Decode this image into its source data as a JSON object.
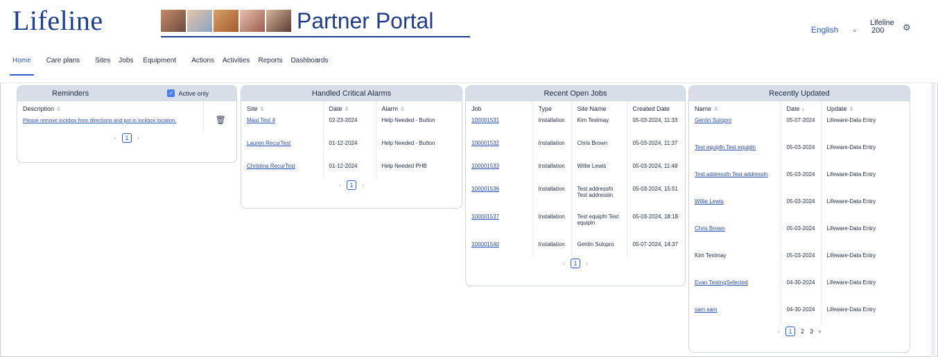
{
  "header": {
    "brand": "Lifeline",
    "portal_title": "Partner Portal",
    "language": "English",
    "user_line1": "Lifeline",
    "user_line2": "200"
  },
  "nav": [
    "Home",
    "Care plans",
    "Sites",
    "Jobs",
    "Equipment",
    "Actions",
    "Activities",
    "Reports",
    "Dashboards"
  ],
  "colors": {
    "accent": "#2a5bd7",
    "brand": "#1c3f8f",
    "panel_header": "#d7dee7"
  },
  "reminders": {
    "title": "Reminders",
    "active_only": "Active only",
    "col_description": "Description",
    "rows": [
      {
        "description": "Please remove lockbox from directions and put in lockbox location."
      }
    ],
    "page": "1"
  },
  "alarms": {
    "title": "Handled Critical Alarms",
    "cols": [
      "Site",
      "Date",
      "Alarm"
    ],
    "rows": [
      {
        "site": "Maui Test 4",
        "date": "02-23-2024",
        "alarm": "Help Needed - Button"
      },
      {
        "site": "Lauren RecurTest",
        "date": "01-12-2024",
        "alarm": "Help Needed - Button"
      },
      {
        "site": "Christina RecurTest",
        "date": "01-12-2024",
        "alarm": "Help Needed PHB"
      }
    ],
    "page": "1"
  },
  "jobs": {
    "title": "Recent Open Jobs",
    "cols": [
      "Job",
      "Type",
      "Site Name",
      "Created Date"
    ],
    "rows": [
      {
        "job": "100001531",
        "type": "Installation",
        "site": "Kim Testmay",
        "date": "05-03-2024, 11:33"
      },
      {
        "job": "100001532",
        "type": "Installation",
        "site": "Chris Brown",
        "date": "05-03-2024, 11:37"
      },
      {
        "job": "100001533",
        "type": "Installation",
        "site": "Willie Lewis",
        "date": "05-03-2024, 11:48"
      },
      {
        "job": "100001536",
        "type": "Installation",
        "site": "Test addressfn Test addressln",
        "date": "05-03-2024, 15:51"
      },
      {
        "job": "100001537",
        "type": "Installation",
        "site": "Test equipfn Test equipln",
        "date": "05-03-2024, 18:18"
      },
      {
        "job": "100001540",
        "type": "Installation",
        "site": "Gentin Sulopro",
        "date": "05-07-2024, 14:37"
      }
    ],
    "page": "1"
  },
  "updated": {
    "title": "Recently Updated",
    "cols": [
      "Name",
      "Date",
      "Update"
    ],
    "rows": [
      {
        "name": "Gentin Sulopro",
        "date": "05-07-2024",
        "update": "Lifeware-Data Entry",
        "link": true
      },
      {
        "name": "Test equipfn Test equipln",
        "date": "05-03-2024",
        "update": "Lifeware-Data Entry",
        "link": true
      },
      {
        "name": "Test addressfn Test addressln",
        "date": "05-03-2024",
        "update": "Lifeware-Data Entry",
        "link": true
      },
      {
        "name": "Willie Lewis",
        "date": "05-03-2024",
        "update": "Lifeware-Data Entry",
        "link": true
      },
      {
        "name": "Chris Brown",
        "date": "05-03-2024",
        "update": "Lifeware-Data Entry",
        "link": true
      },
      {
        "name": "Kim Testmay",
        "date": "05-03-2024",
        "update": "Lifeware-Data Entry",
        "link": false
      },
      {
        "name": "Evan TestingSelected",
        "date": "04-30-2024",
        "update": "Lifeware-Data Entry",
        "link": true
      },
      {
        "name": "sam sam",
        "date": "04-30-2024",
        "update": "Lifeware-Data Entry",
        "link": true
      }
    ],
    "pages": [
      "1",
      "2",
      "3"
    ]
  }
}
